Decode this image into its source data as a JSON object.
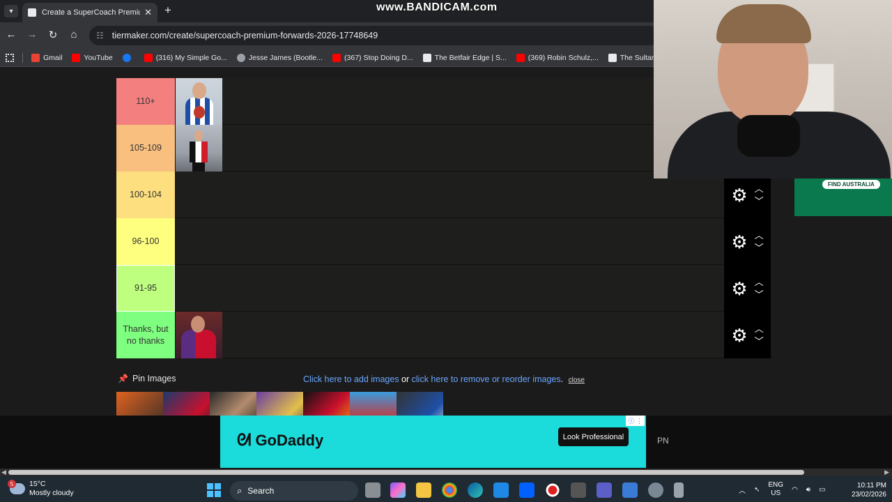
{
  "browser": {
    "tab_title": "Create a SuperCoach Premium",
    "new_tab": "+",
    "overlay_watermark": "www.BANDICAM.com",
    "url": "tiermaker.com/create/supercoach-premium-forwards-2026-17748649",
    "bookmarks": [
      {
        "label": "Gmail",
        "color": "#ea4335"
      },
      {
        "label": "YouTube",
        "color": "#ff0000"
      },
      {
        "label": "",
        "color": "#1877f2"
      },
      {
        "label": "(316) My Simple Go...",
        "color": "#ff0000"
      },
      {
        "label": "Jesse James (Bootle...",
        "color": "#9aa0a6"
      },
      {
        "label": "(367) Stop Doing D...",
        "color": "#ff0000"
      },
      {
        "label": "The Betfair Edge | S...",
        "color": "#e8eaed"
      },
      {
        "label": "(369) Robin Schulz,...",
        "color": "#ff0000"
      },
      {
        "label": "The Sultan (@su",
        "color": "#e8eaed"
      }
    ]
  },
  "tiers": [
    {
      "label": "110+",
      "color": "#f47f7f",
      "players": [
        "north"
      ]
    },
    {
      "label": "105-109",
      "color": "#f9bf7f",
      "players": [
        "saints"
      ]
    },
    {
      "label": "100-104",
      "color": "#fddf7f",
      "players": []
    },
    {
      "label": "96-100",
      "color": "#feff7f",
      "players": []
    },
    {
      "label": "91-95",
      "color": "#bfff7f",
      "players": []
    },
    {
      "label": "Thanks, but no thanks",
      "color": "#7fff7f",
      "players": [
        "blues"
      ]
    }
  ],
  "pin": {
    "label": "Pin Images",
    "add_link": "Click here to add images",
    "or": " or ",
    "remove_link": "click here to remove or reorder images",
    "period": ".",
    "close": "close"
  },
  "ad": {
    "brand": "GoDaddy",
    "cta": "Look Professional",
    "side_text": "PN",
    "badge": "FIND AUSTRALIA"
  },
  "taskbar": {
    "weather_temp": "15°C",
    "weather_desc": "Mostly cloudy",
    "weather_badge": "5",
    "search": "Search",
    "lang1": "ENG",
    "lang2": "US",
    "time": "10:11 PM",
    "date": "23/02/2026"
  }
}
